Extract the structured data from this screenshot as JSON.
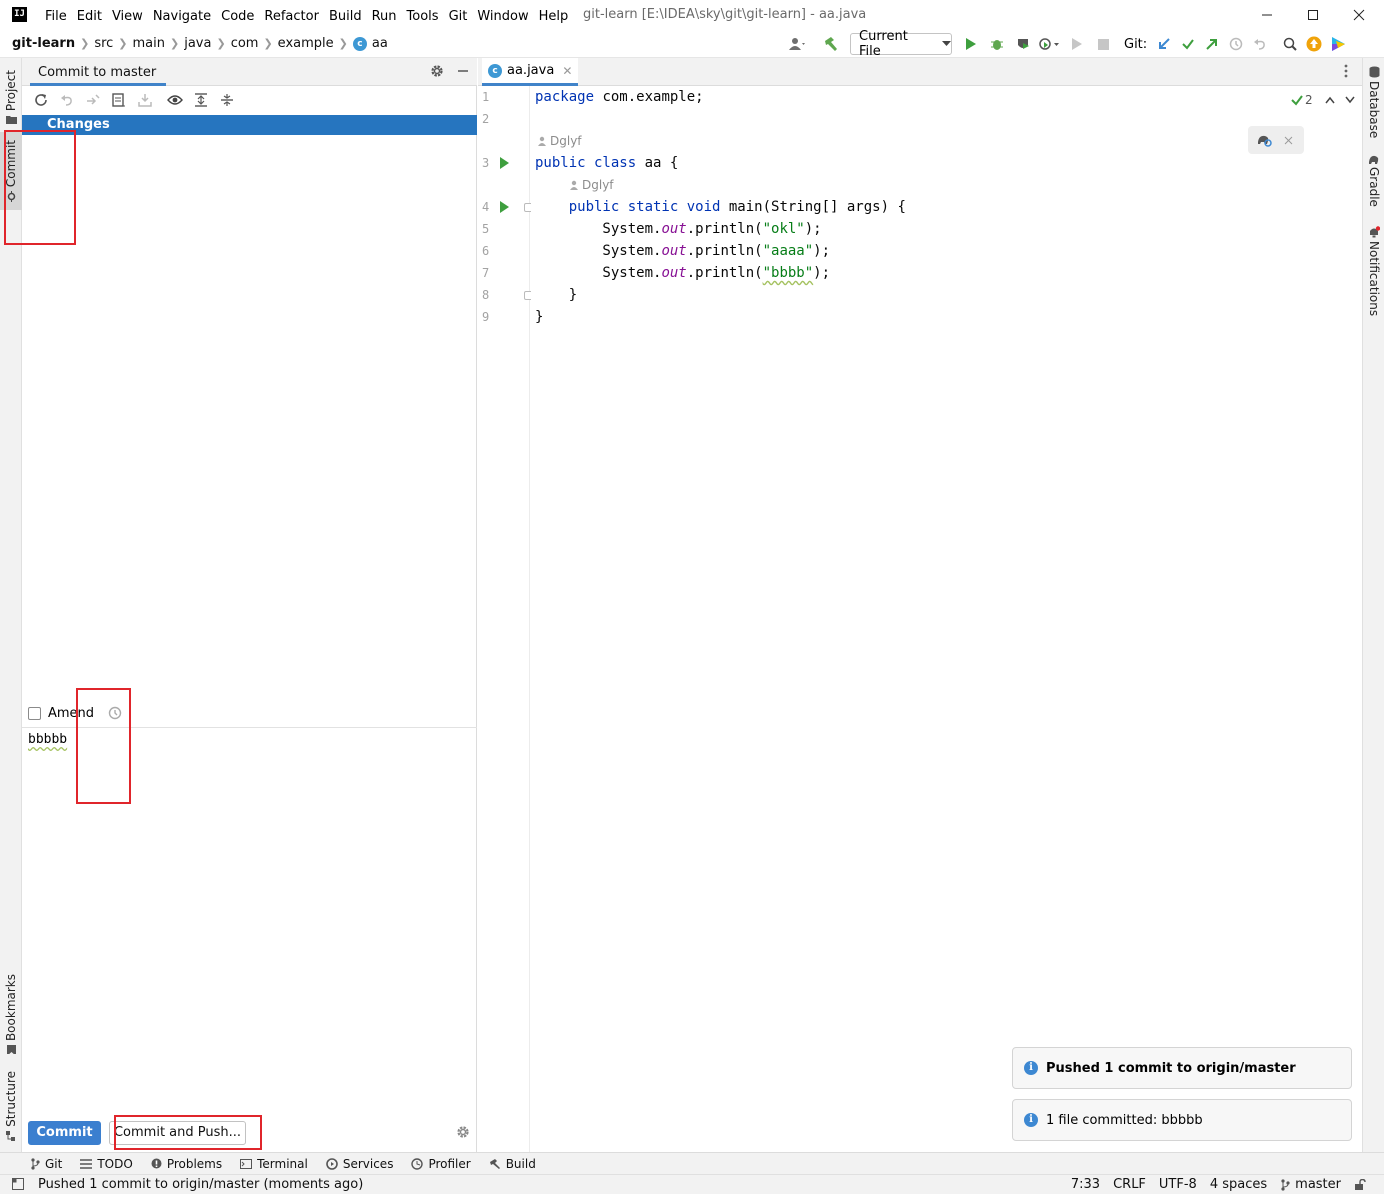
{
  "app": {
    "logo_text": "IJ",
    "window_title": "git-learn [E:\\IDEA\\sky\\git\\git-learn] - aa.java",
    "menu": [
      "File",
      "Edit",
      "View",
      "Navigate",
      "Code",
      "Refactor",
      "Build",
      "Run",
      "Tools",
      "Git",
      "Window",
      "Help"
    ]
  },
  "breadcrumb": [
    "git-learn",
    "src",
    "main",
    "java",
    "com",
    "example",
    "aa"
  ],
  "toolbar": {
    "run_config": "Current File",
    "git_label": "Git:"
  },
  "left_tools": [
    "Project",
    "Commit",
    "Bookmarks",
    "Structure"
  ],
  "right_tools": [
    "Database",
    "Gradle",
    "Notifications"
  ],
  "commit_panel": {
    "title": "Commit to master",
    "changes_label": "Changes",
    "amend_label": "Amend",
    "amend_checked": false,
    "message": "bbbbb",
    "commit_button": "Commit",
    "commit_push_button": "Commit and Push..."
  },
  "editor": {
    "tab_label": "aa.java",
    "inspection_count": "2",
    "author": "Dglyf",
    "lines": [
      {
        "n": "1",
        "tokens": [
          {
            "t": "package ",
            "c": "kw"
          },
          {
            "t": "com.example;",
            "c": ""
          }
        ]
      },
      {
        "n": "2",
        "tokens": []
      },
      {
        "n": "3",
        "tokens": [
          {
            "t": "public class ",
            "c": "kw"
          },
          {
            "t": "aa {",
            "c": ""
          }
        ]
      },
      {
        "n": "4",
        "tokens": [
          {
            "t": "    public static void ",
            "c": "kw"
          },
          {
            "t": "main(String[] args) {",
            "c": ""
          }
        ]
      },
      {
        "n": "5",
        "tokens": [
          {
            "t": "        System.",
            "c": ""
          },
          {
            "t": "out",
            "c": "fld"
          },
          {
            "t": ".println(",
            "c": ""
          },
          {
            "t": "\"okl\"",
            "c": "str"
          },
          {
            "t": ");",
            "c": ""
          }
        ]
      },
      {
        "n": "6",
        "tokens": [
          {
            "t": "        System.",
            "c": ""
          },
          {
            "t": "out",
            "c": "fld"
          },
          {
            "t": ".println(",
            "c": ""
          },
          {
            "t": "\"aaaa\"",
            "c": "str"
          },
          {
            "t": ");",
            "c": ""
          }
        ]
      },
      {
        "n": "7",
        "tokens": [
          {
            "t": "        System.",
            "c": ""
          },
          {
            "t": "out",
            "c": "fld"
          },
          {
            "t": ".println(",
            "c": ""
          },
          {
            "t": "\"bbbb\"",
            "c": "str"
          },
          {
            "t": ");",
            "c": ""
          }
        ]
      },
      {
        "n": "8",
        "tokens": [
          {
            "t": "    }",
            "c": ""
          }
        ]
      },
      {
        "n": "9",
        "tokens": [
          {
            "t": "}",
            "c": ""
          }
        ]
      }
    ]
  },
  "notifications": [
    {
      "text": "Pushed 1 commit to origin/master",
      "bold": true
    },
    {
      "text": "1 file committed: bbbbb",
      "bold": false
    }
  ],
  "bottom_tools": [
    "Git",
    "TODO",
    "Problems",
    "Terminal",
    "Services",
    "Profiler",
    "Build"
  ],
  "status": {
    "message": "Pushed 1 commit to origin/master (moments ago)",
    "position": "7:33",
    "line_sep": "CRLF",
    "encoding": "UTF-8",
    "indent": "4 spaces",
    "branch": "master"
  },
  "colors": {
    "accent": "#2675bf",
    "annotation": "#e0252b",
    "keyword": "#0033b3",
    "string": "#067d17",
    "field": "#871094"
  }
}
